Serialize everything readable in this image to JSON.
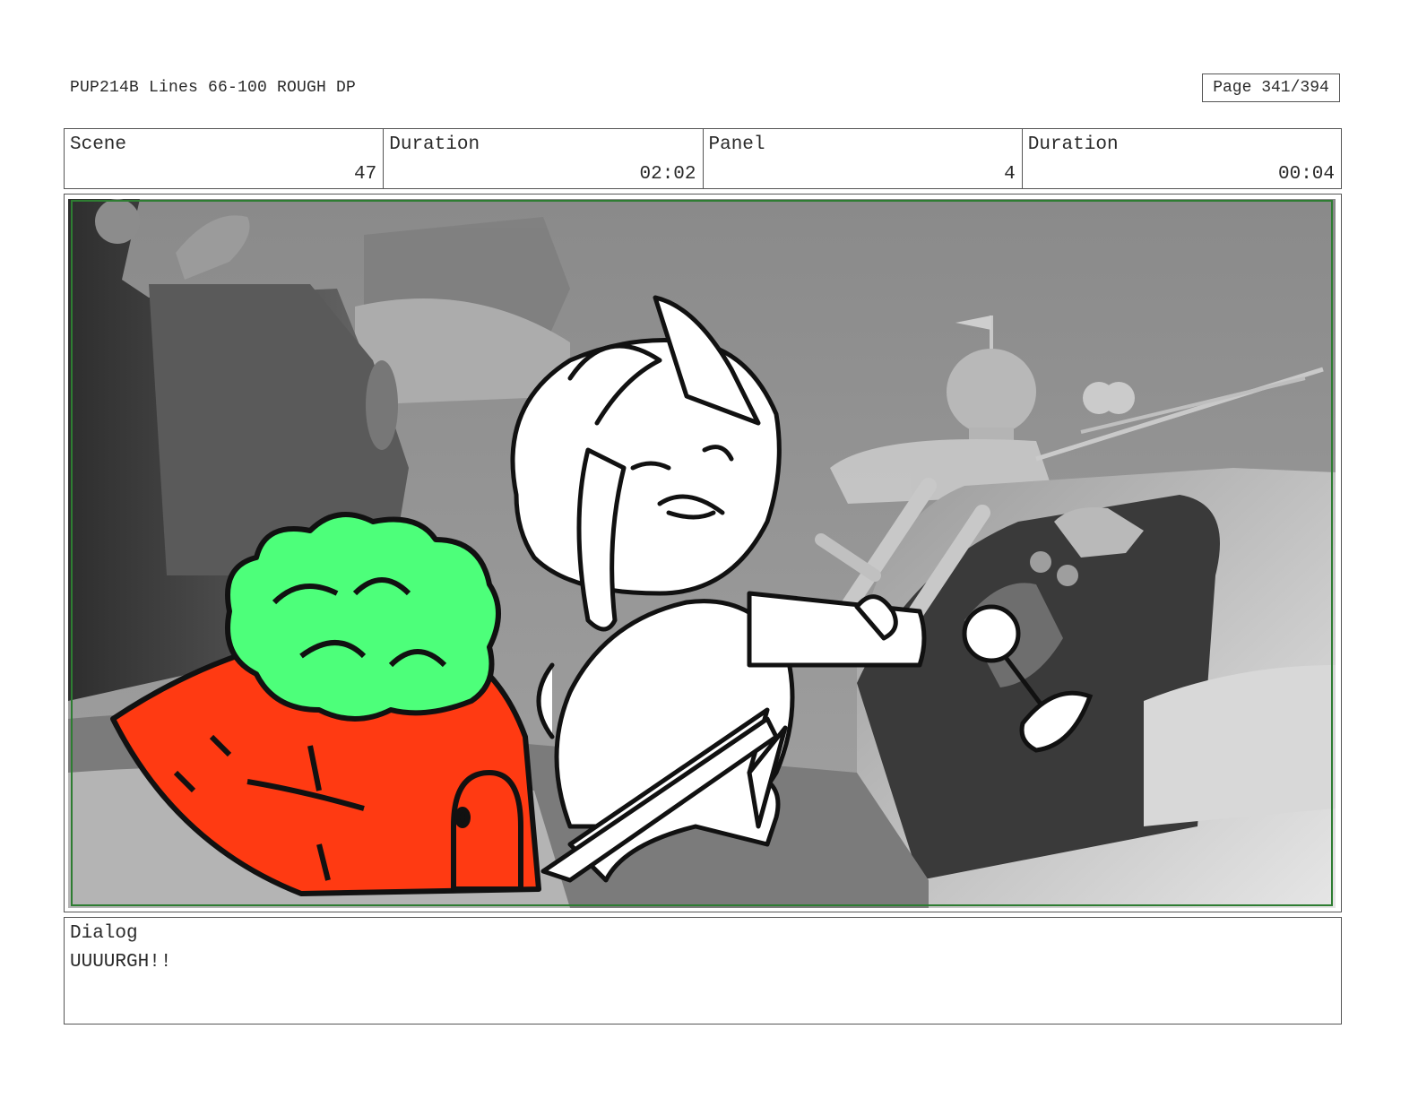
{
  "header": {
    "title": "PUP214B Lines 66-100 ROUGH DP",
    "page": "Page 341/394"
  },
  "info": {
    "scene_label": "Scene",
    "scene_value": "47",
    "scene_duration_label": "Duration",
    "scene_duration_value": "02:02",
    "panel_label": "Panel",
    "panel_value": "4",
    "panel_duration_label": "Duration",
    "panel_duration_value": "00:04"
  },
  "panel": {
    "border_color": "#2e7d32",
    "colors": {
      "background": "#8e8e8e",
      "carrot": "#ff3a12",
      "carrot_top": "#4dff7a",
      "outline": "#111111"
    }
  },
  "dialog": {
    "label": "Dialog",
    "text": "UUUURGH!!"
  }
}
